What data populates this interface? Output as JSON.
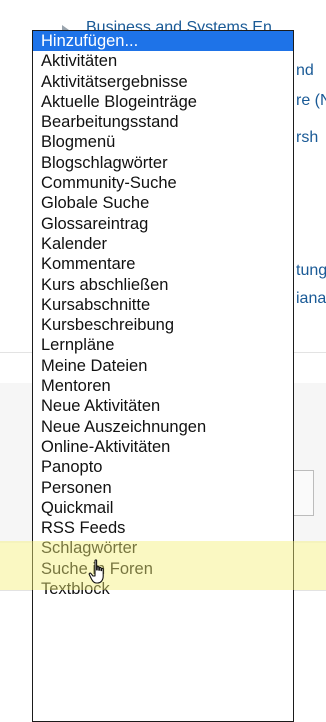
{
  "background": {
    "top_link": "Business and Systems En",
    "right_fragments": [
      "nd",
      "re (N",
      "rsh",
      "tung",
      "iana"
    ]
  },
  "dropdown": {
    "options": [
      "Hinzufügen...",
      "Aktivitäten",
      "Aktivitätsergebnisse",
      "Aktuelle Blogeinträge",
      "Bearbeitungsstand",
      "Blogmenü",
      "Blogschlagwörter",
      "Community-Suche",
      "Globale Suche",
      "Glossareintrag",
      "Kalender",
      "Kommentare",
      "Kurs abschließen",
      "Kursabschnitte",
      "Kursbeschreibung",
      "Lernpläne",
      "Meine Dateien",
      "Mentoren",
      "Neue Aktivitäten",
      "Neue Auszeichnungen",
      "Online-Aktivitäten",
      "Panopto",
      "Personen",
      "Quickmail",
      "RSS Feeds",
      "Schlagwörter",
      "Suche in Foren",
      "Textblock"
    ],
    "selected_index": 0,
    "hovered_index": 22
  },
  "colors": {
    "selected_bg": "#1e73e8",
    "highlight": "#f5f078",
    "link": "#1a5a96"
  },
  "icons": {
    "cursor": "hand-pointer-icon"
  }
}
